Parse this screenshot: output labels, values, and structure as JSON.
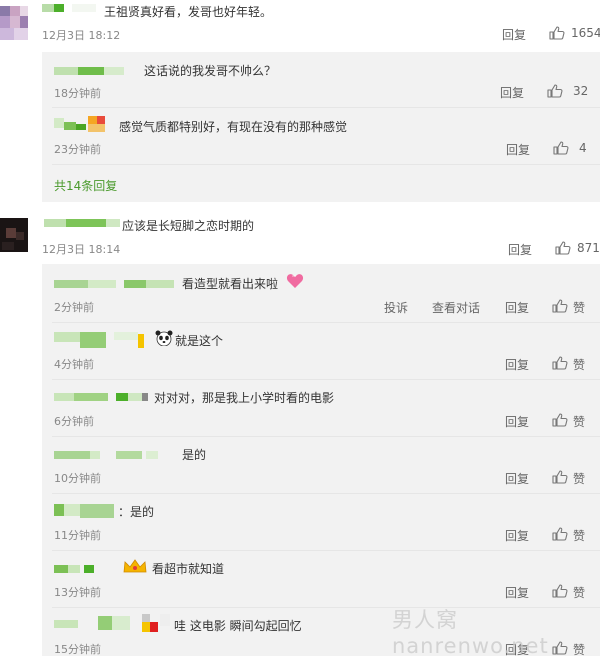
{
  "comments": [
    {
      "text": "王祖贤真好看，发哥也好年轻。",
      "time": "12月3日 18:12",
      "reply": "回复",
      "likes": "1654",
      "subs": [
        {
          "text": "这话说的我发哥不帅么？",
          "time": "18分钟前",
          "reply": "回复",
          "likes": "32"
        },
        {
          "text": "感觉气质都特别好，有现在没有的那种感觉",
          "time": "23分钟前",
          "reply": "回复",
          "likes": "4"
        }
      ],
      "more": "共14条回复"
    },
    {
      "text": "应该是长短脚之恋时期的",
      "time": "12月3日 18:14",
      "reply": "回复",
      "likes": "871",
      "subs": [
        {
          "text": "看造型就看出来啦",
          "time": "2分钟前",
          "report": "投诉",
          "view": "查看对话",
          "reply": "回复",
          "like": "赞"
        },
        {
          "text": "就是这个",
          "time": "4分钟前",
          "reply": "回复",
          "like": "赞"
        },
        {
          "text": "对对对，那是我上小学时看的电影",
          "time": "6分钟前",
          "reply": "回复",
          "like": "赞"
        },
        {
          "text": "是的",
          "time": "10分钟前",
          "reply": "回复",
          "like": "赞"
        },
        {
          "text": "：是的",
          "time": "11分钟前",
          "reply": "回复",
          "like": "赞"
        },
        {
          "text": "看超市就知道",
          "time": "13分钟前",
          "reply": "回复",
          "like": "赞"
        },
        {
          "text": "哇 这电影 瞬间勾起回忆",
          "time": "15分钟前",
          "reply": "回复",
          "like": "赞"
        }
      ]
    }
  ],
  "watermark": "男人窝nanrenwo.net",
  "colors": {
    "background": "#ffffff",
    "sub_panel": "#f2f2f2",
    "username_green": "#4a9a2c",
    "meta": "#888888"
  }
}
